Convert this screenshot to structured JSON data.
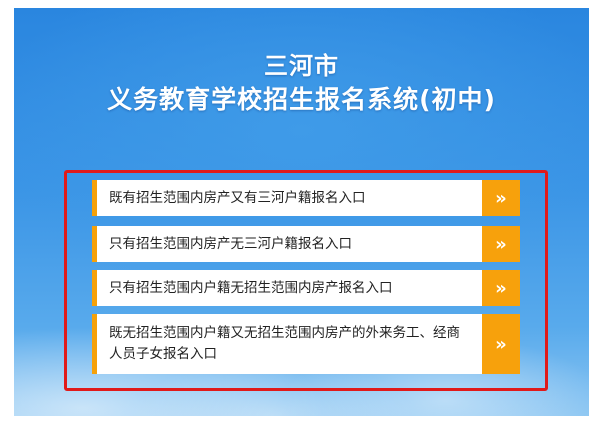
{
  "header": {
    "city": "三河市",
    "system_title": "义务教育学校招生报名系统(初中)"
  },
  "entries": [
    {
      "label": "既有招生范围内房产又有三河户籍报名入口",
      "arrow": "»"
    },
    {
      "label": "只有招生范围内房产无三河户籍报名入口",
      "arrow": "»"
    },
    {
      "label": "只有招生范围内户籍无招生范围内房产报名入口",
      "arrow": "»"
    },
    {
      "label": "既无招生范围内户籍又无招生范围内房产的外来务工、经商人员子女报名入口",
      "arrow": "»"
    }
  ],
  "colors": {
    "accent": "#f7a10c",
    "highlight_frame": "#e01a1a",
    "background_blue": "#2a86df"
  }
}
